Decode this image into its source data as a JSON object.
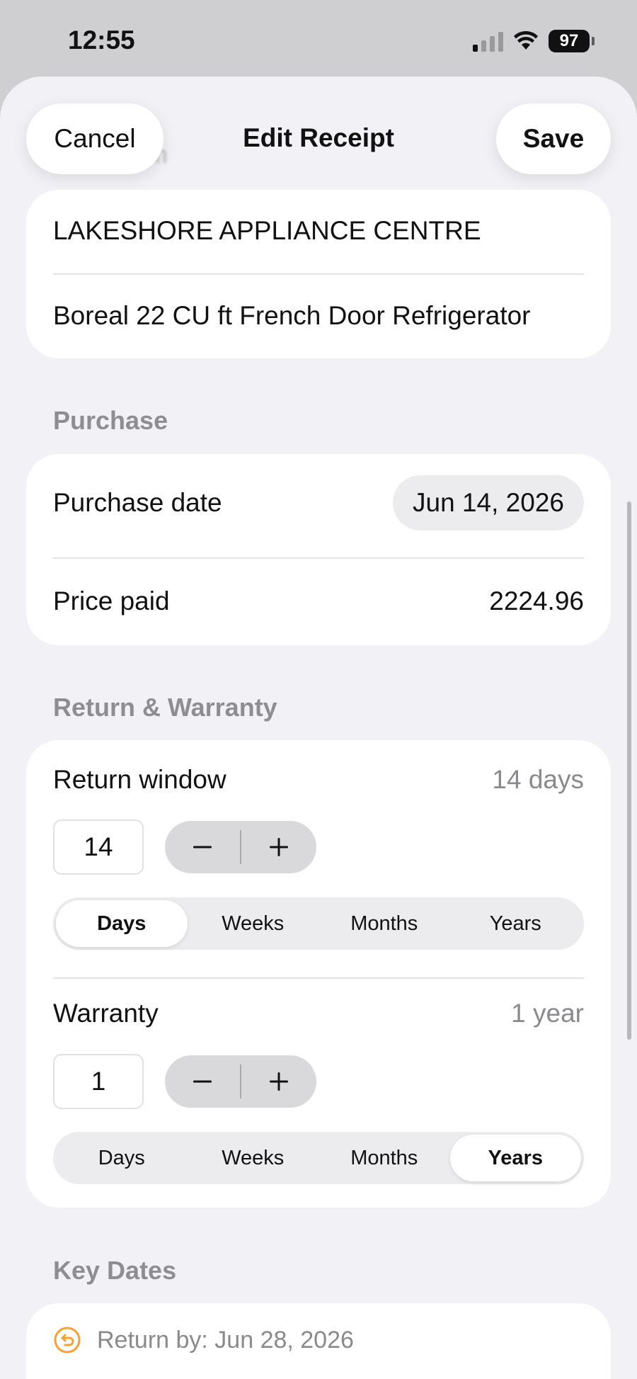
{
  "status_bar": {
    "time": "12:55",
    "battery": "97",
    "icons": [
      "cellular-signal-icon",
      "wifi-icon",
      "battery-icon"
    ]
  },
  "nav": {
    "cancel_label": "Cancel",
    "title": "Edit Receipt",
    "save_label": "Save",
    "obscured_text": "tem"
  },
  "item": {
    "store": "LAKESHORE APPLIANCE CENTRE",
    "product": "Boreal 22 CU ft French Door Refrigerator"
  },
  "purchase": {
    "section_label": "Purchase",
    "date_label": "Purchase date",
    "date_value": "Jun 14, 2026",
    "price_label": "Price paid",
    "price_value": "2224.96"
  },
  "return_warranty": {
    "section_label": "Return & Warranty",
    "return": {
      "label": "Return window",
      "summary": "14 days",
      "amount": "14",
      "minus": "−",
      "plus": "+",
      "units": [
        "Days",
        "Weeks",
        "Months",
        "Years"
      ],
      "selected_unit": "Days"
    },
    "warranty": {
      "label": "Warranty",
      "summary": "1 year",
      "amount": "1",
      "minus": "−",
      "plus": "+",
      "units": [
        "Days",
        "Weeks",
        "Months",
        "Years"
      ],
      "selected_unit": "Years"
    }
  },
  "key_dates": {
    "section_label": "Key Dates",
    "return_by": "Return by: Jun 28, 2026",
    "accent_color": "#f0a13a"
  }
}
